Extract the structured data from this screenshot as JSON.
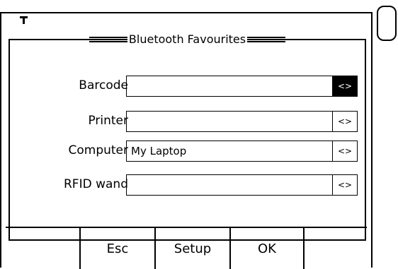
{
  "status": {
    "icon": "bluetooth-icon"
  },
  "dialog": {
    "title": "Bluetooth Favourites",
    "rows": [
      {
        "label": "Barcode",
        "value": "",
        "selector": "<>",
        "active": true
      },
      {
        "label": "Printer",
        "value": "",
        "selector": "<>",
        "active": false
      },
      {
        "label": "Computer",
        "value": "My Laptop",
        "selector": "<>",
        "active": false
      },
      {
        "label": "RFID wand",
        "value": "",
        "selector": "<>",
        "active": false
      }
    ]
  },
  "softkeys": [
    {
      "label": ""
    },
    {
      "label": "Esc"
    },
    {
      "label": "Setup"
    },
    {
      "label": "OK"
    },
    {
      "label": ""
    }
  ]
}
